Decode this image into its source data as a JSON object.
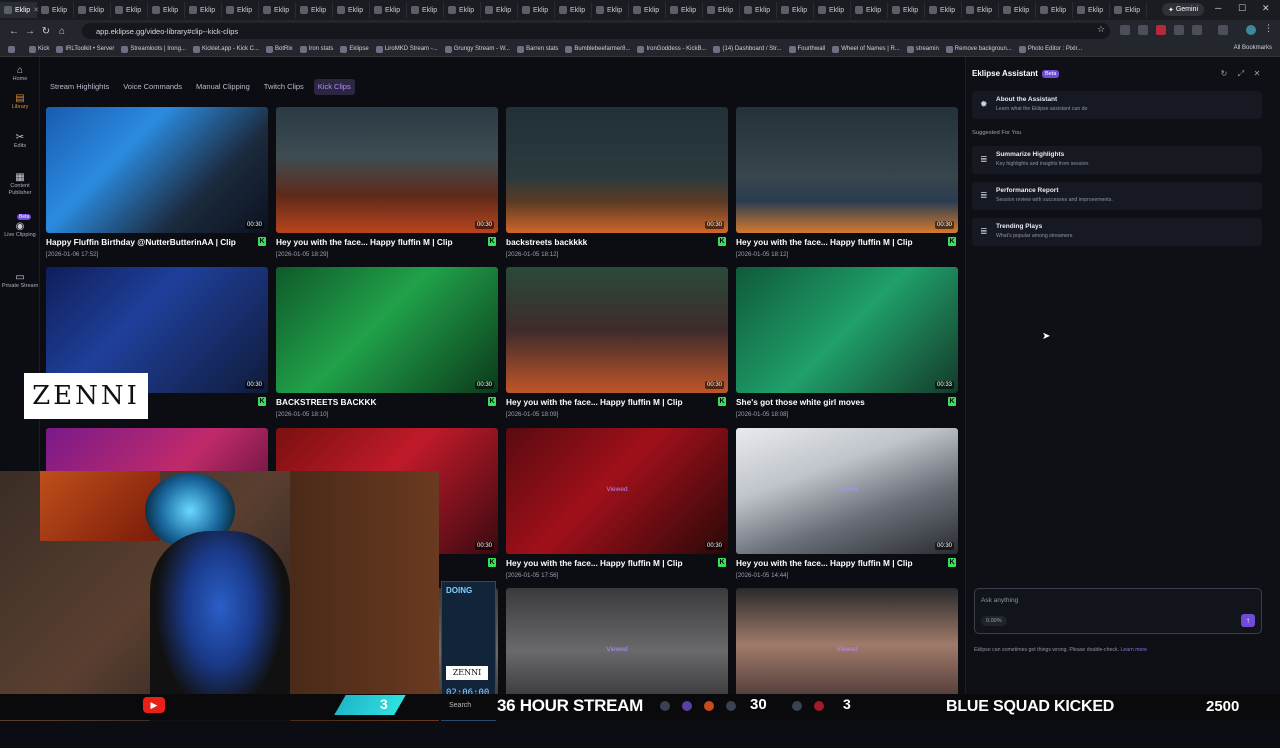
{
  "browser": {
    "tab_label": "Eklip",
    "tab_count": 31,
    "gemini_label": "Gemini",
    "url": "app.eklipse.gg/video-library#clip--kick-clips",
    "bookmarks": [
      "Kick",
      "IRLToolkit • Server",
      "Streamloots | Irong...",
      "Kicklet.app - Kick C...",
      "BotRix",
      "Iron stats",
      "Eklipse",
      "LiroMKD Stream -...",
      "Grungy Stream - W...",
      "Barren stats",
      "Bumblebeefarmer8...",
      "IronGoddess - KickB...",
      "(14) Dashboard / Str...",
      "Fourthwall",
      "Wheel of Names | R...",
      "streamin",
      "Remove backgroun...",
      "Photo Editor : Pixlr..."
    ],
    "all_bookmarks": "All Bookmarks"
  },
  "sidebar": {
    "items": [
      {
        "label": "Home",
        "icon": "home-icon"
      },
      {
        "label": "Library",
        "icon": "library-icon"
      },
      {
        "label": "Edits",
        "icon": "scissors-icon"
      },
      {
        "label": "Content Publisher",
        "icon": "calendar-icon"
      },
      {
        "label": "Live Clipping",
        "icon": "live-icon"
      },
      {
        "label": "Private Stream",
        "icon": "camera-icon"
      }
    ],
    "beta_badge": "Beta"
  },
  "filter_tabs": [
    "Stream Highlights",
    "Voice Commands",
    "Manual Clipping",
    "Twitch Clips",
    "Kick Clips"
  ],
  "active_tab": "Kick Clips",
  "clips": [
    {
      "title": "Happy Fluffin Birthday @NutterButterinAA | Clip",
      "date": "[2026-01-06 17:52]",
      "duration": "00:30"
    },
    {
      "title": "Hey you with the face... Happy fluffin M | Clip",
      "date": "[2026-01-05 18:29]",
      "duration": "00:30"
    },
    {
      "title": "backstreets backkkk",
      "date": "[2026-01-05 18:12]",
      "duration": "00:30"
    },
    {
      "title": "Hey you with the face... Happy fluffin M | Clip",
      "date": "[2026-01-05 18:12]",
      "duration": "00:30"
    },
    {
      "title": "appy fluffin M | Clip",
      "date": "",
      "duration": "00:30"
    },
    {
      "title": "BACKSTREETS BACKKK",
      "date": "[2026-01-05 18:10]",
      "duration": "00:30"
    },
    {
      "title": "Hey you with the face... Happy fluffin M | Clip",
      "date": "[2026-01-05 18:09]",
      "duration": "00:30"
    },
    {
      "title": "She's got those white girl moves",
      "date": "[2026-01-05 18:08]",
      "duration": "00:33"
    },
    {
      "title": "",
      "date": "",
      "duration": ""
    },
    {
      "title": "Clip",
      "date": "",
      "duration": "00:30"
    },
    {
      "title": "Hey you with the face... Happy fluffin M | Clip",
      "date": "[2026-01-05 17:56]",
      "duration": "00:30"
    },
    {
      "title": "Hey you with the face... Happy fluffin M | Clip",
      "date": "[2026-01-05 14:44]",
      "duration": "00:30"
    },
    {
      "title": "",
      "date": "",
      "duration": ""
    },
    {
      "title": "",
      "date": "",
      "duration": ""
    },
    {
      "title": "",
      "date": "",
      "duration": ""
    },
    {
      "title": "",
      "date": "",
      "duration": ""
    }
  ],
  "viewed_label": "Viewed",
  "overlay": {
    "brand": "ZENNI",
    "panel_doing": "DOING",
    "panel_logo": "ZENNI",
    "panel_time": "02:06:00"
  },
  "assistant": {
    "title": "Eklipse Assistant",
    "beta": "Beta",
    "about_title": "About the Assistant",
    "about_sub": "Learn what the Eklipse assistant can do",
    "suggested_label": "Suggested For You",
    "suggestions": [
      {
        "title": "Summarize Highlights",
        "sub": "Key highlights and insights from session."
      },
      {
        "title": "Performance Report",
        "sub": "Session review with successes and improvements."
      },
      {
        "title": "Trending Plays",
        "sub": "What's popular among streamers."
      }
    ],
    "input_placeholder": "Ask anything",
    "usage_pct": "0.00%",
    "disclaimer": "Eklipse can sometimes get things wrong. Please double-check.",
    "learn_more": "Learn more"
  },
  "taskbar": {
    "search": "Search",
    "stream_text": "36 HOUR STREAM",
    "count_a": "3",
    "count_30": "30",
    "count_b": "3",
    "kicked_text": "BLUE SQUAD KICKED",
    "total": "2500"
  }
}
